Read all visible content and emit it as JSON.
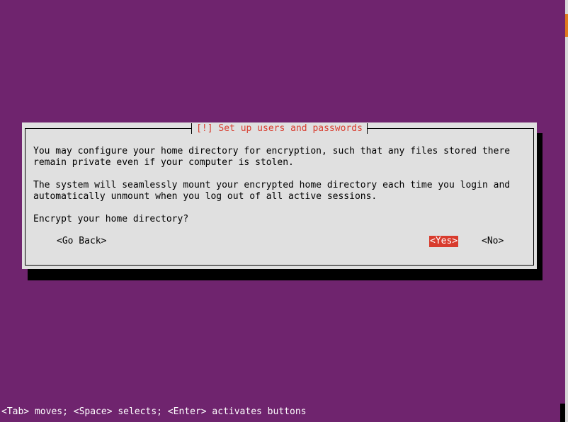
{
  "dialog": {
    "title": "[!] Set up users and passwords",
    "lines": [
      "You may configure your home directory for encryption, such that any files stored there",
      "remain private even if your computer is stolen.",
      "The system will seamlessly mount your encrypted home directory each time you login and",
      "automatically unmount when you log out of all active sessions.",
      "Encrypt your home directory?"
    ],
    "buttons": {
      "back": "<Go Back>",
      "yes": "<Yes>",
      "no": "<No>"
    },
    "selected_button": "yes"
  },
  "footer": "<Tab> moves; <Space> selects; <Enter> activates buttons",
  "colors": {
    "background": "#6f246e",
    "dialog": "#e0e0e0",
    "accent": "#d83c2e"
  }
}
